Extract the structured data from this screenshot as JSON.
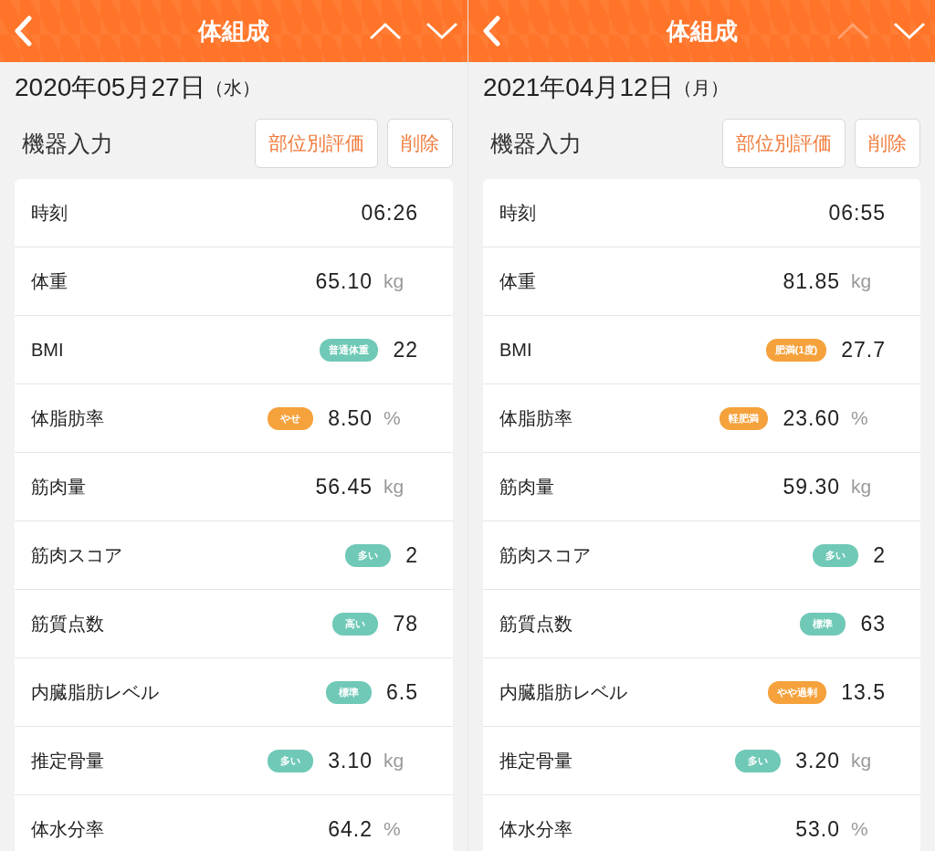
{
  "panels": [
    {
      "title": "体組成",
      "prev_disabled": false,
      "next_disabled": false,
      "date": "2020年05月27日",
      "weekday": "（水）",
      "section_title": "機器入力",
      "buttons": [
        "部位別評価",
        "削除"
      ],
      "rows": [
        {
          "label": "時刻",
          "value": "06:26"
        },
        {
          "label": "体重",
          "value": "65.10",
          "unit": "kg"
        },
        {
          "label": "BMI",
          "value": "22",
          "badge": {
            "text": "普通体重",
            "color": "#6fc9b6"
          }
        },
        {
          "label": "体脂肪率",
          "value": "8.50",
          "unit": "%",
          "badge": {
            "text": "やせ",
            "color": "#f5a23c"
          }
        },
        {
          "label": "筋肉量",
          "value": "56.45",
          "unit": "kg"
        },
        {
          "label": "筋肉スコア",
          "value": "2",
          "badge": {
            "text": "多い",
            "color": "#6fc9b6"
          }
        },
        {
          "label": "筋質点数",
          "value": "78",
          "badge": {
            "text": "高い",
            "color": "#6fc9b6"
          }
        },
        {
          "label": "内臓脂肪レベル",
          "value": "6.5",
          "badge": {
            "text": "標準",
            "color": "#6fc9b6"
          }
        },
        {
          "label": "推定骨量",
          "value": "3.10",
          "unit": "kg",
          "badge": {
            "text": "多い",
            "color": "#6fc9b6"
          }
        },
        {
          "label": "体水分率",
          "value": "64.2",
          "unit": "%"
        }
      ]
    },
    {
      "title": "体組成",
      "prev_disabled": true,
      "next_disabled": false,
      "date": "2021年04月12日",
      "weekday": "（月）",
      "section_title": "機器入力",
      "buttons": [
        "部位別評価",
        "削除"
      ],
      "rows": [
        {
          "label": "時刻",
          "value": "06:55"
        },
        {
          "label": "体重",
          "value": "81.85",
          "unit": "kg"
        },
        {
          "label": "BMI",
          "value": "27.7",
          "badge": {
            "text": "肥満(1度)",
            "color": "#f5a23c"
          }
        },
        {
          "label": "体脂肪率",
          "value": "23.60",
          "unit": "%",
          "badge": {
            "text": "軽肥満",
            "color": "#f5a23c"
          }
        },
        {
          "label": "筋肉量",
          "value": "59.30",
          "unit": "kg"
        },
        {
          "label": "筋肉スコア",
          "value": "2",
          "badge": {
            "text": "多い",
            "color": "#6fc9b6"
          }
        },
        {
          "label": "筋質点数",
          "value": "63",
          "badge": {
            "text": "標準",
            "color": "#6fc9b6"
          }
        },
        {
          "label": "内臓脂肪レベル",
          "value": "13.5",
          "badge": {
            "text": "やや過剰",
            "color": "#f5a23c"
          }
        },
        {
          "label": "推定骨量",
          "value": "3.20",
          "unit": "kg",
          "badge": {
            "text": "多い",
            "color": "#6fc9b6"
          }
        },
        {
          "label": "体水分率",
          "value": "53.0",
          "unit": "%"
        }
      ]
    }
  ]
}
